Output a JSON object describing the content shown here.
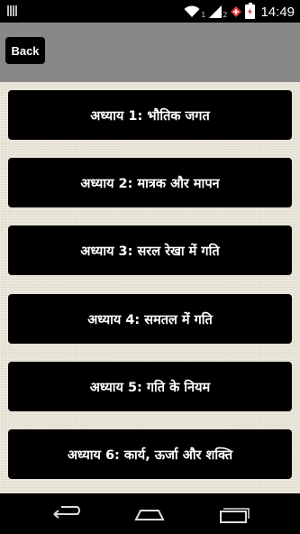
{
  "status_bar": {
    "sim1": "1",
    "sim2": "2",
    "time": "14:49"
  },
  "action_bar": {
    "back_label": "Back"
  },
  "chapters": [
    {
      "label": "अध्याय 1: भौतिक जगत"
    },
    {
      "label": "अध्याय 2: मात्रक और मापन"
    },
    {
      "label": "अध्याय 3: सरल रेखा में गति"
    },
    {
      "label": "अध्याय 4: समतल में गति"
    },
    {
      "label": "अध्याय 5: गति के नियम"
    },
    {
      "label": "अध्याय 6: कार्य, ऊर्जा और शक्ति"
    }
  ],
  "colors": {
    "action_bar": "#888888",
    "button": "#000000",
    "background": "#e9e5d8",
    "battery_alert": "#e53935"
  },
  "icons": {
    "wifi": "wifi-icon",
    "signal": "signal-icon",
    "alert": "alert-icon",
    "battery": "battery-icon",
    "back": "nav-back-icon",
    "home": "nav-home-icon",
    "recent": "nav-recent-icon"
  }
}
